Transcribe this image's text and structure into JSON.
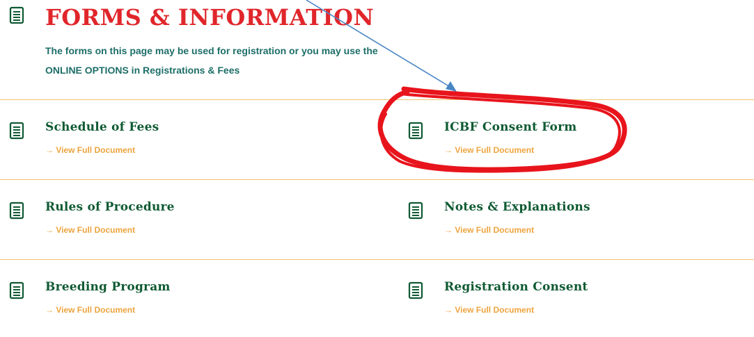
{
  "page": {
    "title": "FORMS & INFORMATION",
    "intro": "The forms on this page may be used for registration or you may use the ONLINE OPTIONS in Registrations & Fees",
    "icon": "document-icon"
  },
  "documents": [
    {
      "title": "Schedule of Fees",
      "link": "→ View Full Document"
    },
    {
      "title": "ICBF Consent Form",
      "link": "→ View Full Document"
    },
    {
      "title": "Rules of Procedure",
      "link": "→ View Full Document"
    },
    {
      "title": "Notes & Explanations",
      "link": "→ View Full Document"
    },
    {
      "title": "Breeding Program",
      "link": "→ View Full Document"
    },
    {
      "title": "Registration Consent",
      "link": "→ View Full Document"
    }
  ],
  "colors": {
    "title": "#e0262b",
    "intro": "#1d6e68",
    "item_title": "#0f5a33",
    "link": "#eda43e",
    "divider": "#f0c46e",
    "annotation_circle": "#e8141c",
    "annotation_arrow": "#4a86c5"
  }
}
